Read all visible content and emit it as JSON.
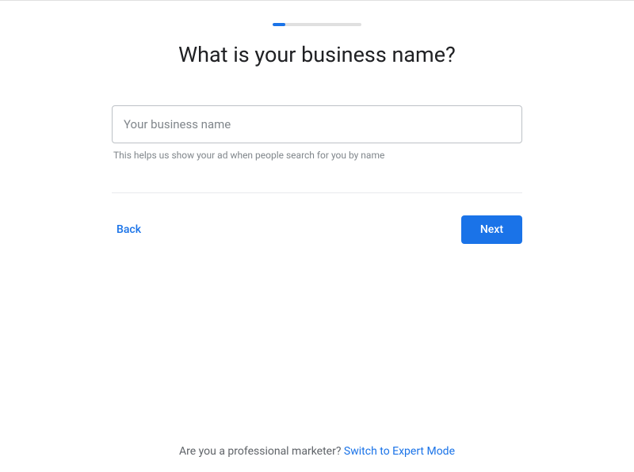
{
  "progress": {
    "percent": 14
  },
  "heading": "What is your business name?",
  "form": {
    "business_name": {
      "value": "",
      "placeholder": "Your business name",
      "helper": "This helps us show your ad when people search for you by name"
    }
  },
  "buttons": {
    "back": "Back",
    "next": "Next"
  },
  "footer": {
    "prompt": "Are you a professional marketer? ",
    "link": "Switch to Expert Mode"
  }
}
